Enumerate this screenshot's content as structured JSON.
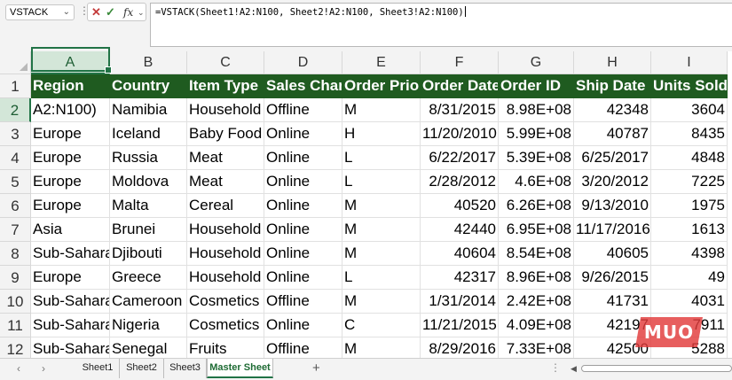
{
  "formula_bar": {
    "name_box": "VSTACK",
    "formula": "=VSTACK(Sheet1!A2:N100, Sheet2!A2:N100, Sheet3!A2:N100)",
    "icons": [
      "cancel-icon",
      "enter-icon",
      "fx-icon"
    ]
  },
  "grid": {
    "columns": [
      "A",
      "B",
      "C",
      "D",
      "E",
      "F",
      "G",
      "H",
      "I"
    ],
    "rows": [
      "1",
      "2",
      "3",
      "4",
      "5",
      "6",
      "7",
      "8",
      "9",
      "10",
      "11",
      "12"
    ],
    "active_cell": "A2",
    "header_color": "#1f5b20",
    "cells": [
      [
        "Region",
        "Country",
        "Item Type",
        "Sales Channel",
        "Order Priority",
        "Order Date",
        "Order ID",
        "Ship Date",
        "Units Sold"
      ],
      [
        "A2:N100)",
        "Namibia",
        "Household",
        "Offline",
        "M",
        "8/31/2015",
        "8.98E+08",
        "42348",
        "3604"
      ],
      [
        "Europe",
        "Iceland",
        "Baby Food",
        "Online",
        "H",
        "11/20/2010",
        "5.99E+08",
        "40787",
        "8435"
      ],
      [
        "Europe",
        "Russia",
        "Meat",
        "Online",
        "L",
        "6/22/2017",
        "5.39E+08",
        "6/25/2017",
        "4848"
      ],
      [
        "Europe",
        "Moldova",
        "Meat",
        "Online",
        "L",
        "2/28/2012",
        "4.6E+08",
        "3/20/2012",
        "7225"
      ],
      [
        "Europe",
        "Malta",
        "Cereal",
        "Online",
        "M",
        "40520",
        "6.26E+08",
        "9/13/2010",
        "1975"
      ],
      [
        "Asia",
        "Brunei",
        "Household",
        "Online",
        "M",
        "42440",
        "6.95E+08",
        "11/17/2016",
        "1613"
      ],
      [
        "Sub-Saharan Africa",
        "Djibouti",
        "Household",
        "Online",
        "M",
        "40604",
        "8.54E+08",
        "40605",
        "4398"
      ],
      [
        "Europe",
        "Greece",
        "Household",
        "Online",
        "L",
        "42317",
        "8.96E+08",
        "9/26/2015",
        "49"
      ],
      [
        "Sub-Saharan Africa",
        "Cameroon",
        "Cosmetics",
        "Offline",
        "M",
        "1/31/2014",
        "2.42E+08",
        "41731",
        "4031"
      ],
      [
        "Sub-Saharan Africa",
        "Nigeria",
        "Cosmetics",
        "Online",
        "C",
        "11/21/2015",
        "4.09E+08",
        "42197",
        "7911"
      ],
      [
        "Sub-Saharan Africa",
        "Senegal",
        "Fruits",
        "Offline",
        "M",
        "8/29/2016",
        "7.33E+08",
        "42500",
        "5288"
      ]
    ]
  },
  "sheet_tabs": {
    "tabs": [
      "Sheet1",
      "Sheet2",
      "Sheet3",
      "Master Sheet"
    ],
    "active": "Master Sheet",
    "add_label": "+"
  },
  "watermark": {
    "text": "MUO",
    "color": "#e23b3b"
  }
}
